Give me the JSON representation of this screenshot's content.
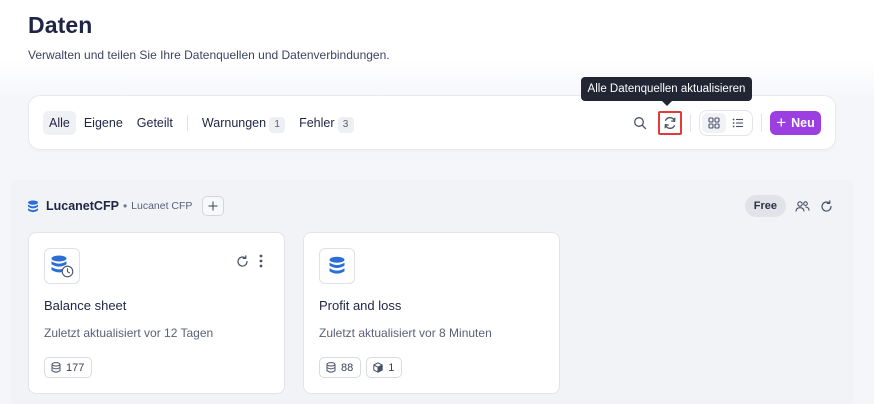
{
  "page": {
    "title": "Daten",
    "subtitle": "Verwalten und teilen Sie Ihre Datenquellen und Datenverbindungen."
  },
  "tooltip": {
    "text": "Alle Datenquellen aktualisieren"
  },
  "toolbar": {
    "filters": [
      {
        "label": "Alle",
        "active": true
      },
      {
        "label": "Eigene",
        "active": false
      },
      {
        "label": "Geteilt",
        "active": false
      }
    ],
    "status_filters": [
      {
        "label": "Warnungen",
        "count": "1"
      },
      {
        "label": "Fehler",
        "count": "3"
      }
    ],
    "icons": {
      "search": "search-icon",
      "refresh_all": "refresh-icon",
      "grid_view": "grid-view-icon",
      "list_view": "list-view-icon"
    },
    "active_view": "grid",
    "new_button_label": "Neu",
    "accent_color": "#9b3fe0",
    "highlight_color": "#e23b3b"
  },
  "group": {
    "name": "LucanetCFP",
    "subtitle": "Lucanet CFP",
    "plan_badge": "Free",
    "cards": [
      {
        "title": "Balance sheet",
        "updated": "Zuletzt aktualisiert vor 12 Tagen",
        "icon": "database-clock-icon",
        "stats": [
          {
            "icon": "database-icon",
            "value": "177"
          }
        ]
      },
      {
        "title": "Profit and loss",
        "updated": "Zuletzt aktualisiert vor 8 Minuten",
        "icon": "database-icon",
        "stats": [
          {
            "icon": "database-icon",
            "value": "88"
          },
          {
            "icon": "cube-icon",
            "value": "1"
          }
        ]
      }
    ]
  }
}
